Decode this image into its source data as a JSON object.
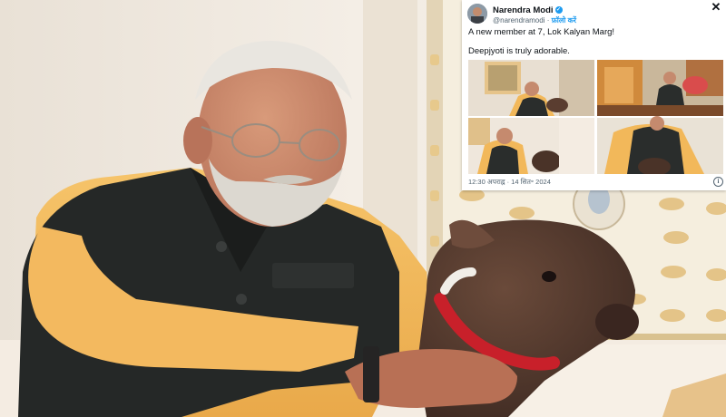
{
  "tweet": {
    "author_name": "Narendra Modi",
    "verified_icon": "verified-badge-icon",
    "handle": "@narendramodi",
    "separator": "·",
    "follow_label": "फ़ॉलो करें",
    "close_icon": "close-icon",
    "close_glyph": "✕",
    "text_line1": "A new member at 7, Lok Kalyan Marg!",
    "text_line2": "Deepjyoti is truly adorable.",
    "timestamp": "12:30 अपराह्न · 14 सित॰ 2024",
    "info_icon": "info-icon",
    "info_glyph": "i"
  },
  "colors": {
    "link_blue": "#1d9bf0",
    "kurta_yellow": "#f0b85a",
    "jacket_black": "#252827",
    "calf_brown": "#4a3328"
  }
}
